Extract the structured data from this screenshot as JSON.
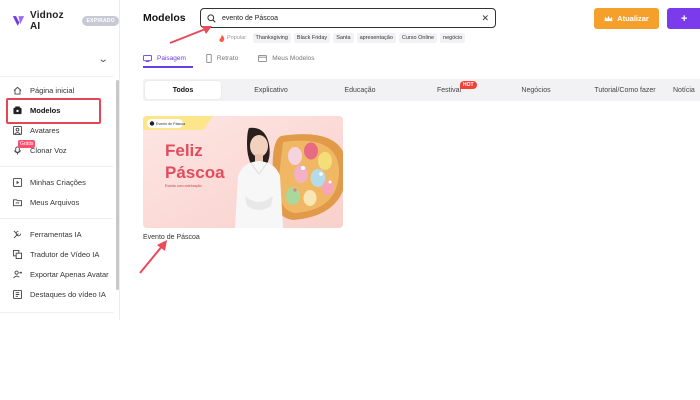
{
  "app": {
    "name": "Vidnoz AI",
    "plan_badge": "EXPIRADO"
  },
  "sidebar": {
    "items": [
      {
        "label": "Página inicial",
        "icon": "home-icon"
      },
      {
        "label": "Modelos",
        "icon": "template-icon",
        "active": true
      },
      {
        "label": "Avatares",
        "icon": "avatar-icon"
      },
      {
        "label": "Clonar Voz",
        "icon": "voice-clone-icon",
        "tag": "Grátis"
      },
      {
        "label": "Minhas Criações",
        "icon": "play-square-icon"
      },
      {
        "label": "Meus Arquivos",
        "icon": "folder-icon"
      },
      {
        "label": "Ferramentas IA",
        "icon": "tools-icon"
      },
      {
        "label": "Tradutor de Vídeo IA",
        "icon": "translate-icon"
      },
      {
        "label": "Exportar Apenas Avatar",
        "icon": "export-avatar-icon"
      },
      {
        "label": "Destaques do vídeo IA",
        "icon": "highlights-icon"
      }
    ]
  },
  "header": {
    "title": "Modelos",
    "search_value": "evento de Páscoa",
    "popular_label": "Popular:",
    "popular_chips": [
      "Thanksgiving",
      "Black Friday",
      "Santa",
      "apresentação",
      "Curso Online",
      "negócio"
    ],
    "update_label": "Atualizar",
    "create_symbol": "+"
  },
  "tabs": [
    {
      "label": "Paisagem",
      "active": true
    },
    {
      "label": "Retrato",
      "active": false
    },
    {
      "label": "Meus Modelos",
      "active": false
    }
  ],
  "categories": [
    "Todos",
    "Explicativo",
    "Educação",
    "Festival",
    "Negócios",
    "Tutorial/Como fazer",
    "Notícia"
  ],
  "hot_badge": "HOT",
  "results": [
    {
      "caption": "Evento de Páscoa",
      "thumb_title_line1": "Feliz",
      "thumb_title_line2": "Páscoa",
      "thumb_subtitle": "Evento com celebração",
      "thumb_brand": "Evento de Páscoa"
    }
  ],
  "colors": {
    "accent": "#6c3bea",
    "update_button": "#f5a02a",
    "create_button": "#7c3aed",
    "highlight": "#e64556",
    "thumb_title": "#e24d5e"
  }
}
